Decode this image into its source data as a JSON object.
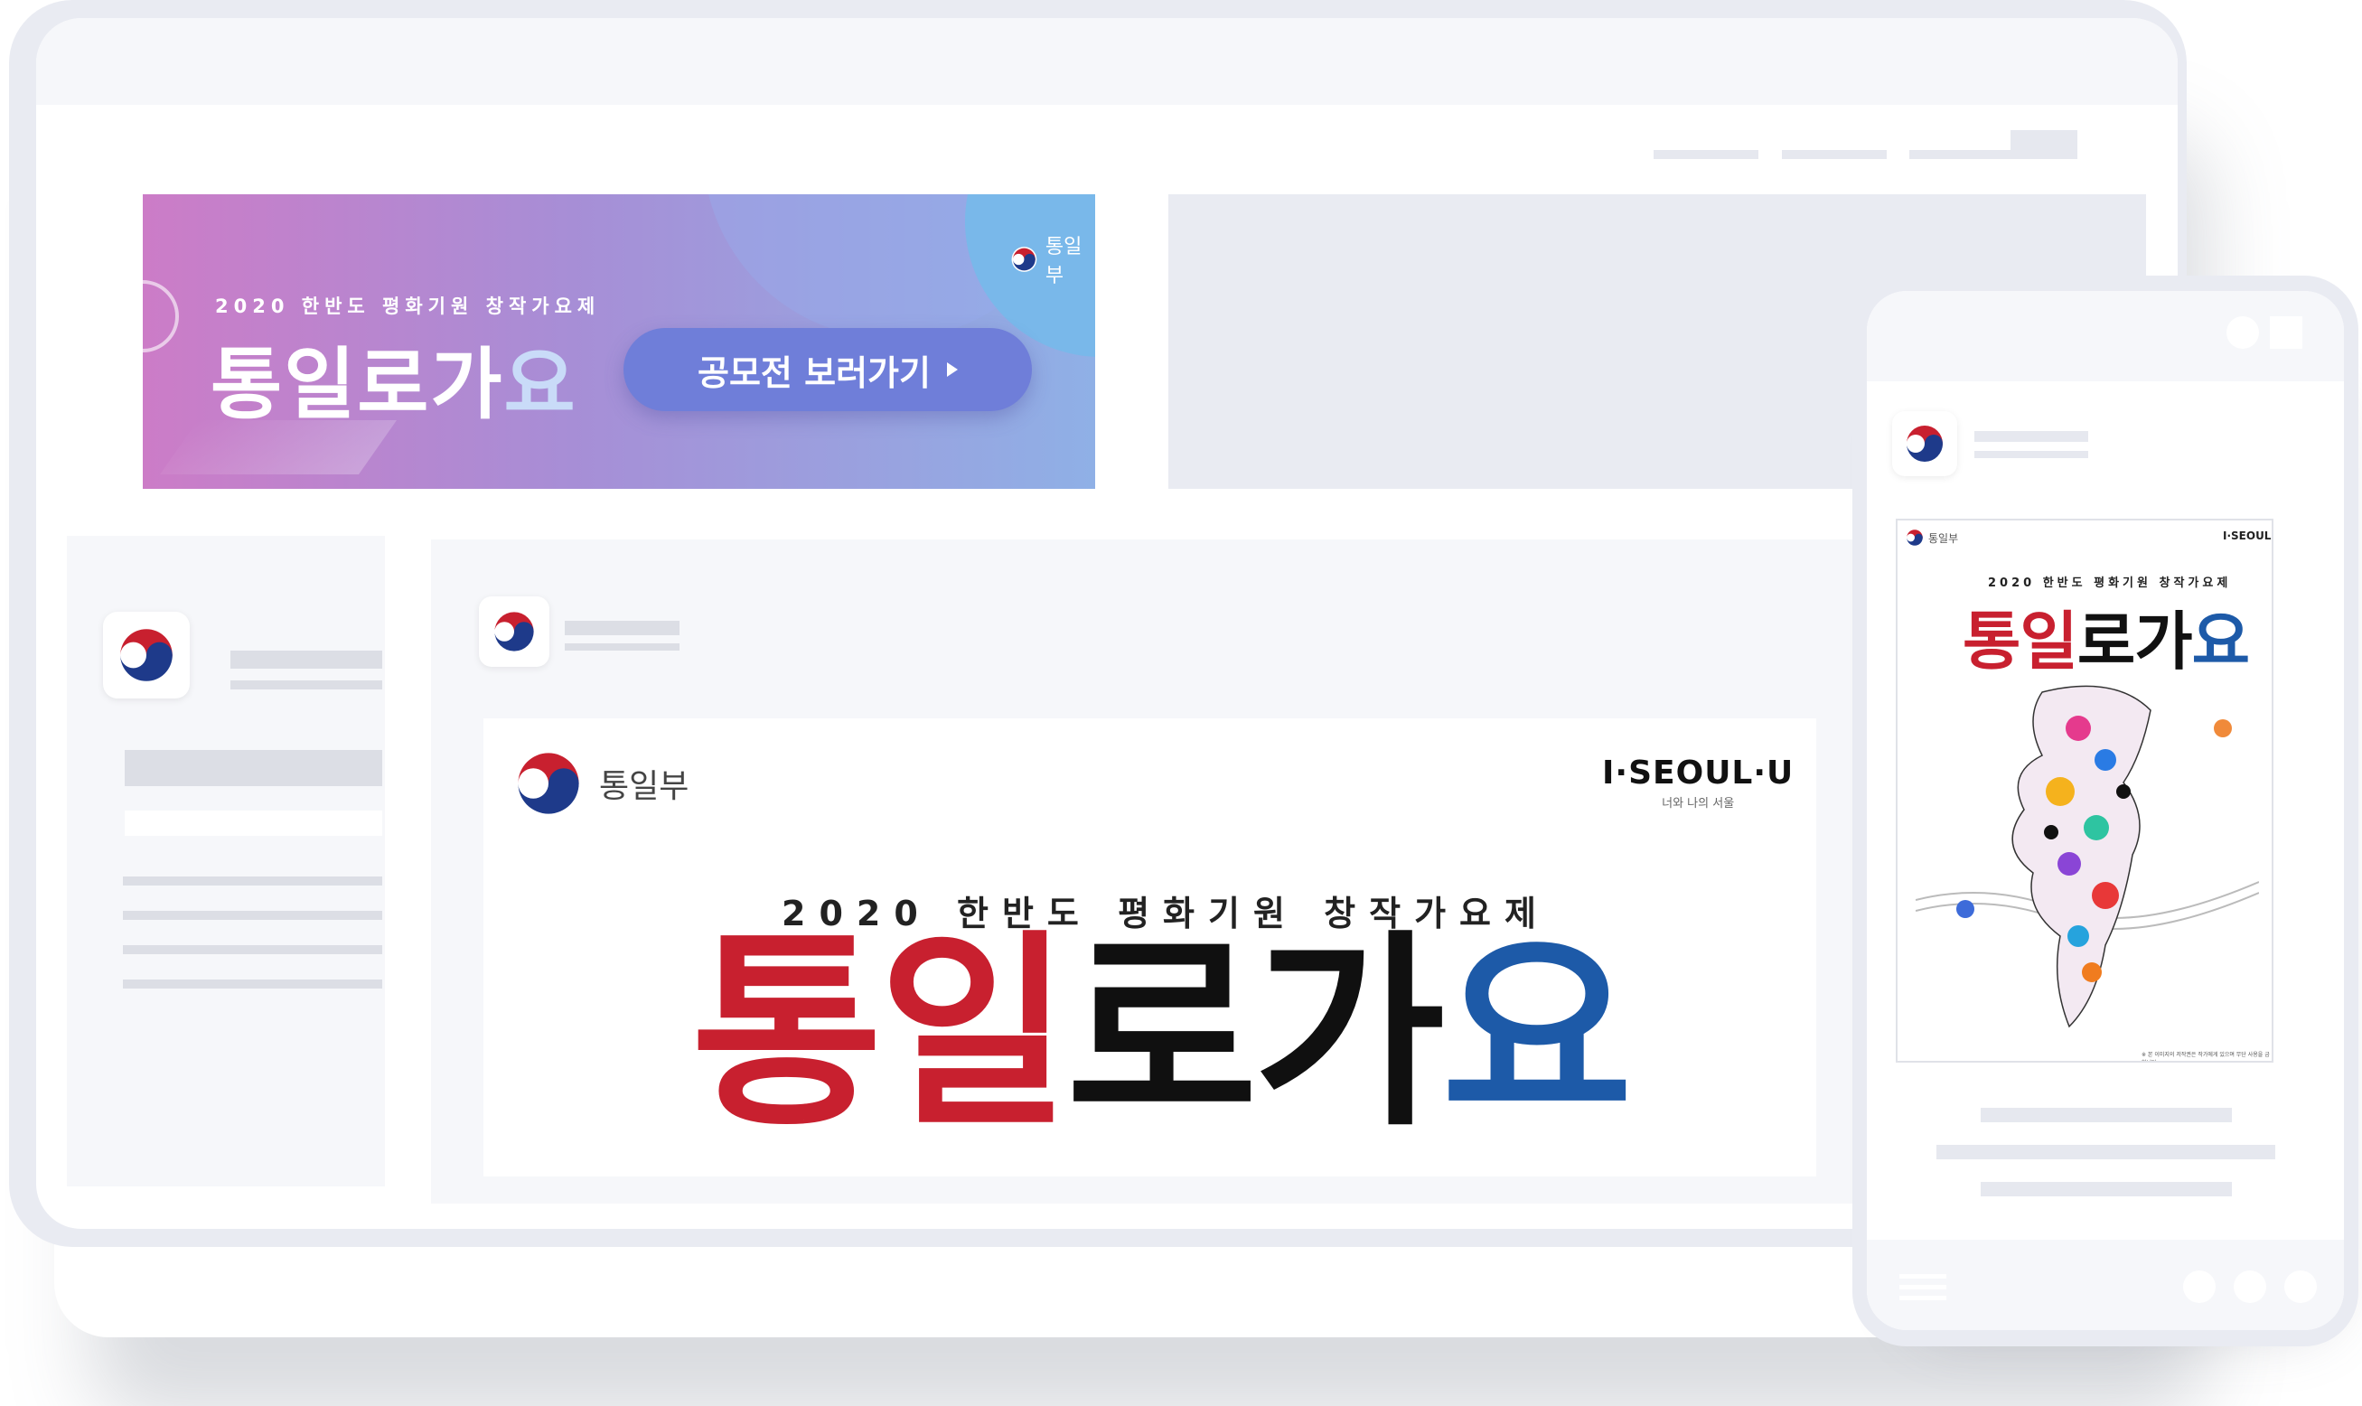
{
  "banner": {
    "org": "통일부",
    "subtitle": "2020 한반도 평화기원 창작가요제",
    "title_main": "통일로가",
    "title_accent": "요",
    "button_label": "공모전 보러가기"
  },
  "poster": {
    "org": "통일부",
    "brand": "I·SEOUL·U",
    "brand_sub": "너와 나의 서울",
    "subtitle": "2020 한반도 평화기원 창작가요제",
    "title_part1": "통",
    "title_part2": "일",
    "title_part3": "로가",
    "title_part4": "요"
  },
  "phone_poster": {
    "org": "통일부",
    "brand": "I·SEOUL·U",
    "subtitle": "2020 한반도 평화기원 창작가요제",
    "title_part1": "통",
    "title_part2": "일",
    "title_part3": "로가",
    "title_part4": "요",
    "footer": "※ 본 이미지의 저작권은 작가에게 있으며 무단 사용을 금합니다."
  },
  "colors": {
    "frame": "#e9ebf2",
    "placeholder": "#dcdee5",
    "accent_red": "#c8202f",
    "accent_blue": "#1d5aa8"
  },
  "icons": [
    "taegeuk-logo-icon",
    "play-triangle-icon",
    "hamburger-icon"
  ]
}
